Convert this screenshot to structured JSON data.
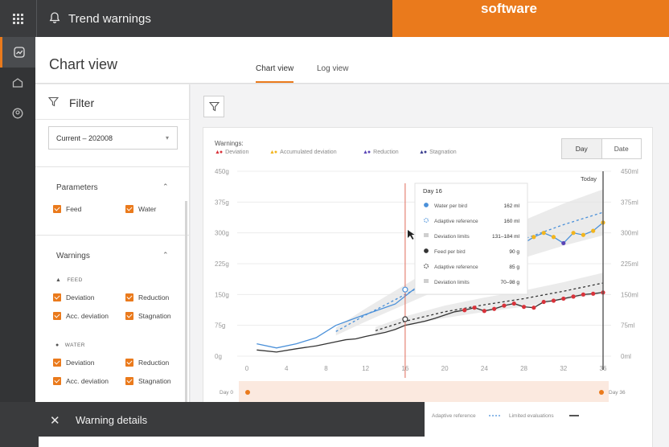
{
  "app": {
    "title": "Trend warnings",
    "brand": "software"
  },
  "header": {
    "title": "Chart view",
    "tabs": [
      {
        "label": "Chart view",
        "active": true
      },
      {
        "label": "Log view",
        "active": false
      }
    ]
  },
  "filter": {
    "title": "Filter",
    "period": "Current – 202008",
    "parameters": {
      "title": "Parameters",
      "items": [
        "Feed",
        "Water"
      ]
    },
    "warnings": {
      "title": "Warnings",
      "feed_label": "FEED",
      "water_label": "WATER",
      "feed_items": [
        "Deviation",
        "Reduction",
        "Acc. deviation",
        "Stagnation"
      ],
      "water_items": [
        "Deviation",
        "Reduction",
        "Acc. deviation",
        "Stagnation"
      ]
    }
  },
  "chart_controls": {
    "warnings_label": "Warnings:",
    "toggle": [
      "Day",
      "Date"
    ],
    "toggle_selected": "Day"
  },
  "colors": {
    "accent": "#ea7a1c",
    "deviation": "#d9323a",
    "acc_deviation": "#f2b51e",
    "reduction": "#5a45b7",
    "stagnation": "#3b3f8f",
    "water": "#4a90d9",
    "feed": "#333333"
  },
  "chart_data": {
    "type": "line",
    "legend": [
      {
        "name": "Deviation",
        "color": "#d9323a"
      },
      {
        "name": "Accumulated deviation",
        "color": "#f2b51e"
      },
      {
        "name": "Reduction",
        "color": "#5a45b7"
      },
      {
        "name": "Stagnation",
        "color": "#3b3f8f"
      }
    ],
    "x_ticks": [
      "0",
      "4",
      "8",
      "12",
      "16",
      "20",
      "24",
      "28",
      "32",
      "36"
    ],
    "xlim": [
      0,
      36
    ],
    "y_left_ticks": [
      "0g",
      "75g",
      "150g",
      "225g",
      "300g",
      "375g",
      "450g"
    ],
    "ylim_left": [
      0,
      450
    ],
    "y_right_ticks": [
      "0ml",
      "75ml",
      "150ml",
      "225ml",
      "300ml",
      "375ml",
      "450ml"
    ],
    "ylim_right": [
      0,
      450
    ],
    "today_label": "Today",
    "today_day": 36,
    "cursor_day": 16,
    "series": [
      {
        "name": "Water per bird",
        "axis": "right",
        "color": "#4a90d9",
        "x": [
          1,
          3,
          5,
          7,
          9,
          11,
          13,
          15,
          17,
          19,
          21,
          22,
          23,
          24,
          25,
          26,
          27,
          28,
          29,
          30,
          31,
          32,
          33,
          34,
          35,
          36
        ],
        "y": [
          30,
          20,
          30,
          45,
          75,
          93,
          110,
          127,
          165,
          185,
          210,
          220,
          230,
          245,
          255,
          265,
          240,
          275,
          290,
          300,
          290,
          275,
          300,
          295,
          305,
          325
        ]
      },
      {
        "name": "Feed per bird",
        "axis": "left",
        "color": "#333333",
        "x": [
          1,
          3,
          5,
          7,
          9,
          10,
          11,
          12,
          14,
          15,
          16,
          17,
          18,
          19,
          20,
          21,
          22,
          23,
          24,
          25,
          26,
          27,
          28,
          29,
          30,
          31,
          32,
          33,
          34,
          35,
          36
        ],
        "y": [
          15,
          10,
          18,
          25,
          35,
          40,
          42,
          48,
          58,
          65,
          75,
          80,
          85,
          92,
          100,
          108,
          112,
          118,
          110,
          115,
          123,
          128,
          120,
          118,
          132,
          135,
          140,
          145,
          150,
          152,
          155
        ]
      },
      {
        "name": "Adaptive reference",
        "axis": "right",
        "style": "dashed",
        "color": "#4a90d9",
        "x": [
          9,
          12,
          16,
          20,
          24,
          28,
          32,
          36
        ],
        "y": [
          60,
          100,
          150,
          200,
          245,
          285,
          320,
          350
        ]
      },
      {
        "name": "Adaptive reference",
        "axis": "left",
        "style": "dashed",
        "color": "#333333",
        "x": [
          13,
          16,
          20,
          24,
          28,
          32,
          36
        ],
        "y": [
          62,
          85,
          108,
          125,
          140,
          158,
          178
        ]
      }
    ],
    "tooltip": {
      "title": "Day 16",
      "rows": [
        {
          "label": "Water per bird",
          "value": "162 ml"
        },
        {
          "label": "Adaptive reference",
          "value": "160 ml"
        },
        {
          "label": "Deviation limits",
          "value": "131–184 ml"
        },
        {
          "label": "Feed per bird",
          "value": "90 g"
        },
        {
          "label": "Adaptive reference",
          "value": "85 g"
        },
        {
          "label": "Deviation limits",
          "value": "70–98 g"
        }
      ]
    },
    "range": {
      "start": "Day 0",
      "end": "Day 36"
    },
    "bottom_legend": [
      {
        "name": "Adaptive reference"
      },
      {
        "name": "Limited evaluations"
      }
    ]
  },
  "details": {
    "title": "Warning details"
  }
}
